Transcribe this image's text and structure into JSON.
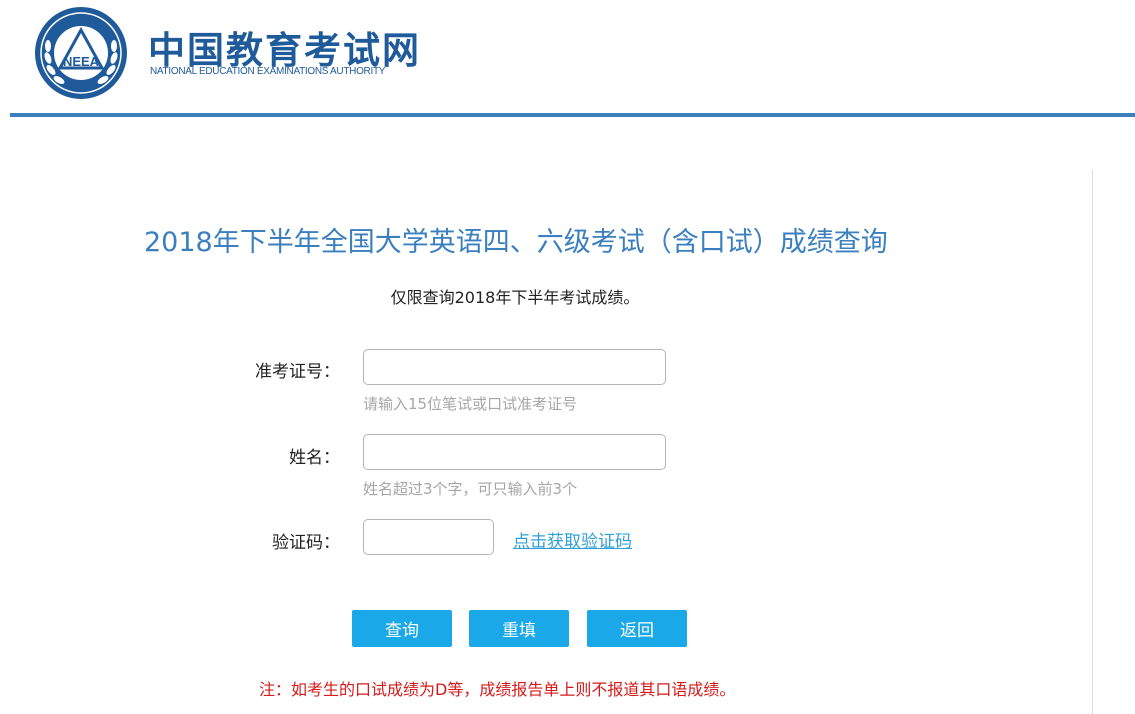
{
  "header": {
    "logo_cn": "中国教育考试网",
    "logo_en": "NATIONAL EDUCATION EXAMINATIONS AUTHORITY",
    "emblem_text": "NEEA"
  },
  "title": "2018年下半年全国大学英语四、六级考试（含口试）成绩查询",
  "subtitle": "仅限查询2018年下半年考试成绩。",
  "form": {
    "ticket": {
      "label": "准考证号：",
      "value": "",
      "hint": "请输入15位笔试或口试准考证号"
    },
    "name": {
      "label": "姓名：",
      "value": "",
      "hint": "姓名超过3个字，可只输入前3个"
    },
    "captcha": {
      "label": "验证码：",
      "value": "",
      "link": "点击获取验证码"
    }
  },
  "buttons": {
    "query": "查询",
    "reset": "重填",
    "back": "返回"
  },
  "note": "注：如考生的口试成绩为D等，成绩报告单上则不报道其口语成绩。",
  "colors": {
    "brand_blue": "#1f5a9a",
    "title_blue": "#3b7fbf",
    "button_blue": "#1aa8e8",
    "link_blue": "#2f9fd8",
    "note_red": "#d61a1a"
  }
}
